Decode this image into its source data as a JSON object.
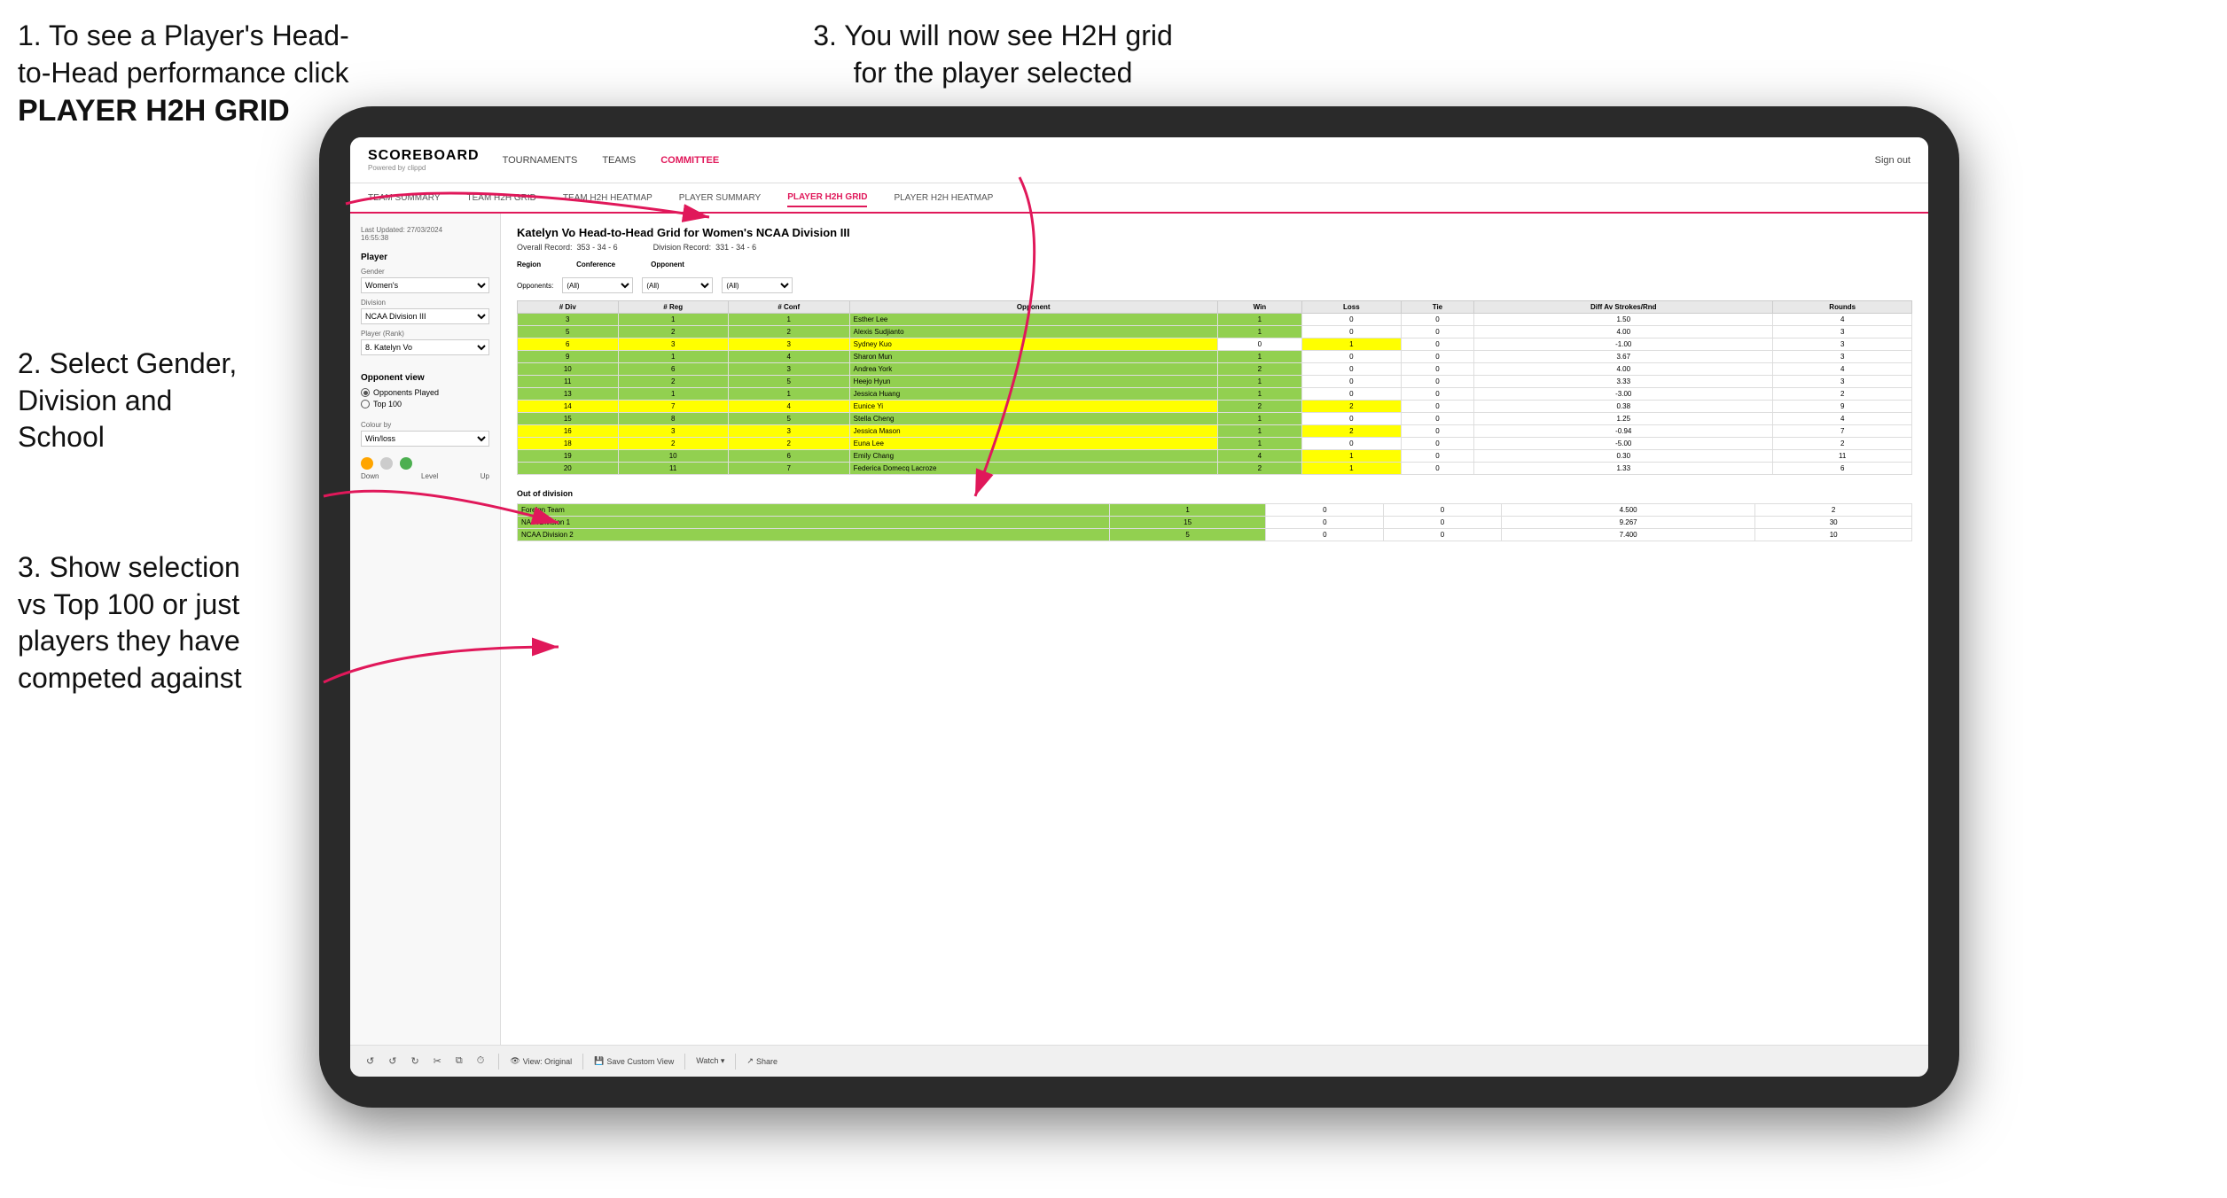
{
  "instructions": {
    "step1_line1": "1. To see a Player's Head-",
    "step1_line2": "to-Head performance click",
    "step1_bold": "PLAYER H2H GRID",
    "step2_line1": "2. Select Gender,",
    "step2_line2": "Division and",
    "step2_line3": "School",
    "step3_left_line1": "3. Show selection",
    "step3_left_line2": "vs Top 100 or just",
    "step3_left_line3": "players they have",
    "step3_left_line4": "competed against",
    "step3_right_line1": "3. You will now see H2H grid",
    "step3_right_line2": "for the player selected"
  },
  "nav": {
    "logo": "SCOREBOARD",
    "logo_sub": "Powered by clippd",
    "items": [
      "TOURNAMENTS",
      "TEAMS",
      "COMMITTEE"
    ],
    "active": "COMMITTEE",
    "sign_out": "Sign out"
  },
  "subnav": {
    "items": [
      "TEAM SUMMARY",
      "TEAM H2H GRID",
      "TEAM H2H HEATMAP",
      "PLAYER SUMMARY",
      "PLAYER H2H GRID",
      "PLAYER H2H HEATMAP"
    ],
    "active": "PLAYER H2H GRID"
  },
  "left_panel": {
    "timestamp": "Last Updated: 27/03/2024",
    "timestamp2": "16:55:38",
    "player_section": "Player",
    "gender_label": "Gender",
    "gender_value": "Women's",
    "division_label": "Division",
    "division_value": "NCAA Division III",
    "player_rank_label": "Player (Rank)",
    "player_rank_value": "8. Katelyn Vo",
    "opponent_view_title": "Opponent view",
    "radio1": "Opponents Played",
    "radio2": "Top 100",
    "colour_by_label": "Colour by",
    "colour_value": "Win/loss",
    "colour_down": "Down",
    "colour_level": "Level",
    "colour_up": "Up"
  },
  "grid": {
    "title": "Katelyn Vo Head-to-Head Grid for Women's NCAA Division III",
    "overall_record_label": "Overall Record:",
    "overall_record": "353 - 34 - 6",
    "division_record_label": "Division Record:",
    "division_record": "331 - 34 - 6",
    "region_label": "Region",
    "conference_label": "Conference",
    "opponent_label": "Opponent",
    "opponents_label": "Opponents:",
    "opponents_filter": "(All)",
    "conference_filter": "(All)",
    "opponent_filter": "(All)",
    "col_div": "# Div",
    "col_reg": "# Reg",
    "col_conf": "# Conf",
    "col_opponent": "Opponent",
    "col_win": "Win",
    "col_loss": "Loss",
    "col_tie": "Tie",
    "col_diff": "Diff Av Strokes/Rnd",
    "col_rounds": "Rounds",
    "rows": [
      {
        "div": 3,
        "reg": 1,
        "conf": 1,
        "opponent": "Esther Lee",
        "win": 1,
        "loss": 0,
        "tie": 0,
        "diff": "1.50",
        "rounds": 4,
        "color": "green"
      },
      {
        "div": 5,
        "reg": 2,
        "conf": 2,
        "opponent": "Alexis Sudjianto",
        "win": 1,
        "loss": 0,
        "tie": 0,
        "diff": "4.00",
        "rounds": 3,
        "color": "green"
      },
      {
        "div": 6,
        "reg": 3,
        "conf": 3,
        "opponent": "Sydney Kuo",
        "win": 0,
        "loss": 1,
        "tie": 0,
        "diff": "-1.00",
        "rounds": 3,
        "color": "yellow"
      },
      {
        "div": 9,
        "reg": 1,
        "conf": 4,
        "opponent": "Sharon Mun",
        "win": 1,
        "loss": 0,
        "tie": 0,
        "diff": "3.67",
        "rounds": 3,
        "color": "green"
      },
      {
        "div": 10,
        "reg": 6,
        "conf": 3,
        "opponent": "Andrea York",
        "win": 2,
        "loss": 0,
        "tie": 0,
        "diff": "4.00",
        "rounds": 4,
        "color": "green"
      },
      {
        "div": 11,
        "reg": 2,
        "conf": 5,
        "opponent": "Heejo Hyun",
        "win": 1,
        "loss": 0,
        "tie": 0,
        "diff": "3.33",
        "rounds": 3,
        "color": "green"
      },
      {
        "div": 13,
        "reg": 1,
        "conf": 1,
        "opponent": "Jessica Huang",
        "win": 1,
        "loss": 0,
        "tie": 0,
        "diff": "-3.00",
        "rounds": 2,
        "color": "green"
      },
      {
        "div": 14,
        "reg": 7,
        "conf": 4,
        "opponent": "Eunice Yi",
        "win": 2,
        "loss": 2,
        "tie": 0,
        "diff": "0.38",
        "rounds": 9,
        "color": "yellow"
      },
      {
        "div": 15,
        "reg": 8,
        "conf": 5,
        "opponent": "Stella Cheng",
        "win": 1,
        "loss": 0,
        "tie": 0,
        "diff": "1.25",
        "rounds": 4,
        "color": "green"
      },
      {
        "div": 16,
        "reg": 3,
        "conf": 3,
        "opponent": "Jessica Mason",
        "win": 1,
        "loss": 2,
        "tie": 0,
        "diff": "-0.94",
        "rounds": 7,
        "color": "yellow"
      },
      {
        "div": 18,
        "reg": 2,
        "conf": 2,
        "opponent": "Euna Lee",
        "win": 1,
        "loss": 0,
        "tie": 0,
        "diff": "-5.00",
        "rounds": 2,
        "color": "yellow"
      },
      {
        "div": 19,
        "reg": 10,
        "conf": 6,
        "opponent": "Emily Chang",
        "win": 4,
        "loss": 1,
        "tie": 0,
        "diff": "0.30",
        "rounds": 11,
        "color": "green"
      },
      {
        "div": 20,
        "reg": 11,
        "conf": 7,
        "opponent": "Federica Domecq Lacroze",
        "win": 2,
        "loss": 1,
        "tie": 0,
        "diff": "1.33",
        "rounds": 6,
        "color": "green"
      }
    ],
    "out_of_division_label": "Out of division",
    "out_rows": [
      {
        "name": "Foreign Team",
        "win": 1,
        "loss": 0,
        "tie": 0,
        "diff": "4.500",
        "rounds": 2,
        "color": "green"
      },
      {
        "name": "NAIA Division 1",
        "win": 15,
        "loss": 0,
        "tie": 0,
        "diff": "9.267",
        "rounds": 30,
        "color": "green"
      },
      {
        "name": "NCAA Division 2",
        "win": 5,
        "loss": 0,
        "tie": 0,
        "diff": "7.400",
        "rounds": 10,
        "color": "green"
      }
    ]
  },
  "toolbar": {
    "undo": "↺",
    "undo2": "↺",
    "redo": "↻",
    "cut": "✂",
    "copy": "⧉",
    "clock": "⏱",
    "view_original": "View: Original",
    "save_custom": "Save Custom View",
    "watch": "Watch ▾",
    "share": "Share"
  }
}
